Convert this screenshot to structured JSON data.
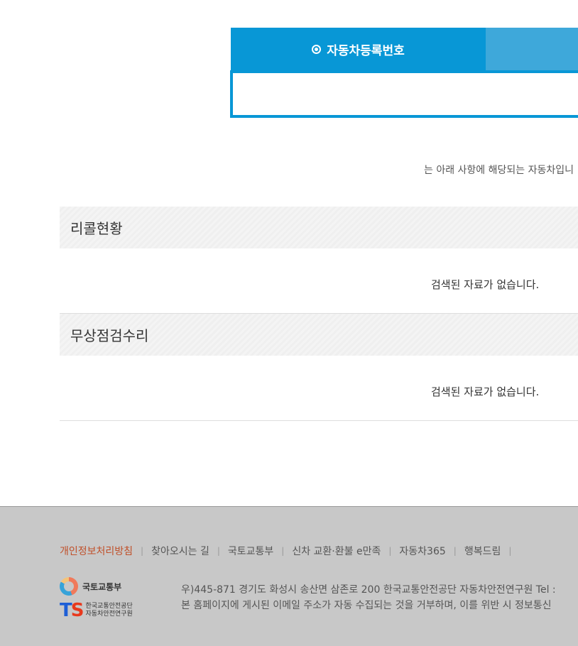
{
  "search": {
    "active_tab_label": "자동차등록번호",
    "input_value": ""
  },
  "notice_text": "는 아래 사항에 해당되는 자동차입니",
  "sections": [
    {
      "title": "리콜현황",
      "empty_message": "검색된 자료가 없습니다."
    },
    {
      "title": "무상점검수리",
      "empty_message": "검색된 자료가 없습니다."
    }
  ],
  "footer": {
    "links": [
      "개인정보처리방침",
      "찾아오시는 길",
      "국토교통부",
      "신차 교환·환불 e만족",
      "자동차365",
      "행복드림"
    ],
    "address_line1": "우)445-871 경기도 화성시 송산면 삼존로 200 한국교통안전공단 자동차안전연구원 Tel :",
    "address_line2": "본 홈페이지에 게시된 이메일 주소가 자동 수집되는 것을 거부하며, 이를 위반 시 정보통신",
    "logo_molit_text": "국토교통부",
    "logo_ts_line1": "한국교통안전공단",
    "logo_ts_line2": "자동차안전연구원",
    "accent_color": "#c0502a"
  },
  "colors": {
    "tab_active": "#0897d6",
    "tab_inactive": "#3ea8da",
    "footer_bg": "#c8c8c8"
  }
}
